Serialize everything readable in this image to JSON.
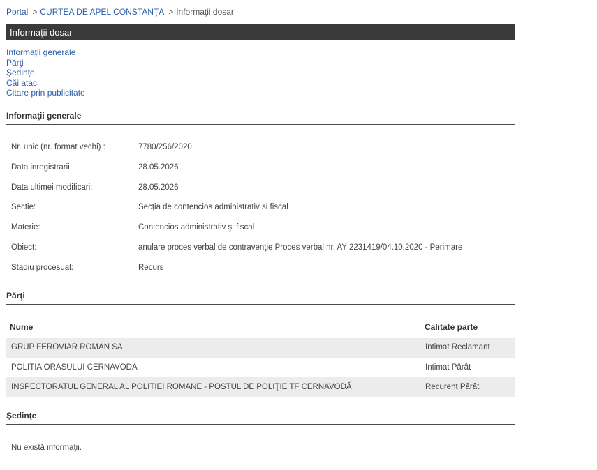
{
  "breadcrumb": {
    "items": [
      "Portal",
      "CURTEA DE APEL CONSTANŢA"
    ],
    "separator": ">",
    "current": "Informaţii dosar"
  },
  "title": "Informaţii dosar",
  "nav_links": [
    "Informaţii generale",
    "Părţi",
    "Şedinţe",
    "Căi atac",
    "Citare prin publicitate"
  ],
  "general": {
    "heading": "Informaţii generale",
    "rows": [
      {
        "label": "Nr. unic (nr. format vechi) :",
        "value": "7780/256/2020"
      },
      {
        "label": "Data inregistrarii",
        "value": "28.05.2026"
      },
      {
        "label": "Data ultimei modificari:",
        "value": "28.05.2026"
      },
      {
        "label": "Sectie:",
        "value": "Secţia de contencios administrativ si fiscal"
      },
      {
        "label": "Materie:",
        "value": "Contencios administrativ şi fiscal"
      },
      {
        "label": "Obiect:",
        "value": "anulare proces verbal de contravenţie Proces verbal nr. AY 2231419/04.10.2020 - Perimare"
      },
      {
        "label": "Stadiu procesual:",
        "value": "Recurs"
      }
    ]
  },
  "parti": {
    "heading": "Părţi",
    "columns": [
      "Nume",
      "Calitate parte"
    ],
    "rows": [
      {
        "nume": "GRUP FEROVIAR ROMAN SA",
        "calitate": "Intimat Reclamant"
      },
      {
        "nume": "POLITIA ORASULUI CERNAVODA",
        "calitate": "Intimat Pârât"
      },
      {
        "nume": "INSPECTORATUL GENERAL AL POLITIEI ROMANE - POSTUL DE POLIŢIE TF CERNAVODĂ",
        "calitate": "Recurent Pârât"
      }
    ]
  },
  "sedinte": {
    "heading": "Şedinţe",
    "empty_message": "Nu există informaţii."
  },
  "colors": {
    "link": "#2a5ea8",
    "title_bar": "#3a3a3a",
    "row_alt": "#ececec"
  }
}
